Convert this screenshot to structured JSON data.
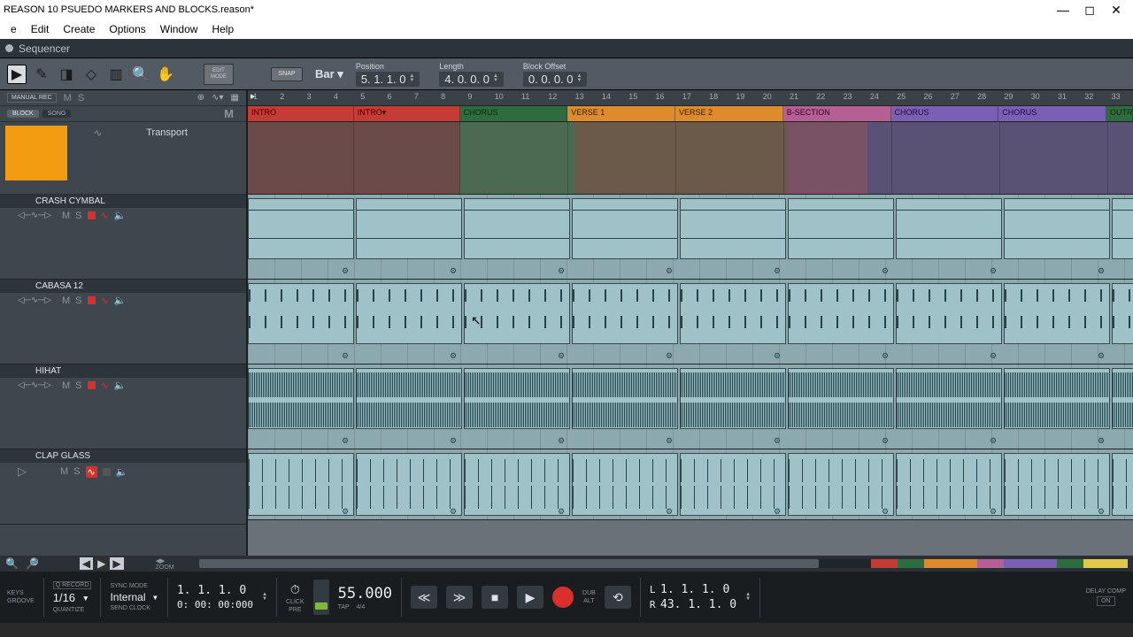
{
  "window": {
    "title": "REASON 10 PSUEDO MARKERS AND BLOCKS.reason*"
  },
  "menu": {
    "items": [
      "e",
      "Edit",
      "Create",
      "Options",
      "Window",
      "Help"
    ]
  },
  "sequencer": {
    "title": "Sequencer"
  },
  "toolbar": {
    "edit_mode": "EDIT\nMODE",
    "snap": "SNAP",
    "bar": "Bar ▾",
    "position": {
      "label": "Position",
      "value": "5.  1.  1.    0"
    },
    "length": {
      "label": "Length",
      "value": "4.  0.  0.    0"
    },
    "block_offset": {
      "label": "Block Offset",
      "value": "0.  0.  0.    0"
    }
  },
  "left": {
    "manual_rec": "MANUAL REC",
    "ms": "M  S",
    "block": "BLOCK",
    "song": "SONG",
    "M": "M",
    "transport": "Transport"
  },
  "tracks": [
    {
      "name": "CRASH CYMBAL"
    },
    {
      "name": "CABASA 12"
    },
    {
      "name": "HIHAT"
    },
    {
      "name": "CLAP GLASS"
    }
  ],
  "ruler": {
    "ticks": [
      1,
      2,
      3,
      4,
      5,
      6,
      7,
      8,
      9,
      10,
      11,
      12,
      13,
      14,
      15,
      16,
      17,
      18,
      19,
      20,
      21,
      22,
      23,
      24,
      25,
      26,
      27,
      28,
      29,
      30,
      31,
      32,
      33
    ]
  },
  "blocks": [
    {
      "label": "INTRO",
      "class": "red",
      "w": 120
    },
    {
      "label": "INTRO▾",
      "class": "red",
      "w": 120
    },
    {
      "label": "CHORUS",
      "class": "green",
      "w": 122
    },
    {
      "label": "VERSE 1",
      "class": "orange",
      "w": 122
    },
    {
      "label": "VERSE 2",
      "class": "orange",
      "w": 122
    },
    {
      "label": "B-SECTION",
      "class": "purple",
      "w": 122
    },
    {
      "label": "CHORUS",
      "class": "violet",
      "w": 122
    },
    {
      "label": "CHORUS",
      "class": "violet",
      "w": 122
    },
    {
      "label": "OUTR",
      "class": "green",
      "w": 30
    }
  ],
  "transport": {
    "keys": "KEYS",
    "groove": "GROOVE",
    "qrecord": "Q RECORD",
    "quant_val": "1/16",
    "quantize": "QUANTIZE",
    "sync_mode": "SYNC MODE",
    "internal": "Internal",
    "send_clock": "SEND CLOCK",
    "pos": "1.   1.   1.     0",
    "time": "0: 00: 00:000",
    "click": "CLICK",
    "pre": "PRE",
    "tempo": "55.000",
    "tap": "TAP",
    "sig": "4/4",
    "dub": "DUB",
    "alt": "ALT",
    "L": "L",
    "R": "R",
    "lval": "1.   1.   1.     0",
    "rval": "43.   1.   1.     0",
    "delay": "DELAY COMP",
    "on": "ON"
  }
}
